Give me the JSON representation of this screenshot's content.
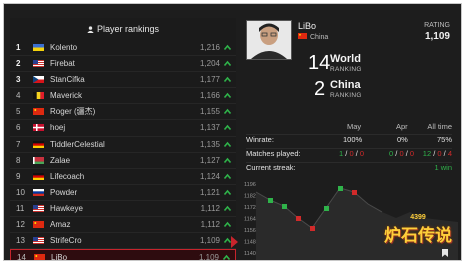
{
  "rankings": {
    "title": "Player rankings",
    "rows": [
      {
        "rank": "1",
        "flag": "ukraine",
        "name": "Kolento",
        "score": "1,216"
      },
      {
        "rank": "2",
        "flag": "usa",
        "name": "Firebat",
        "score": "1,204"
      },
      {
        "rank": "3",
        "flag": "czech",
        "name": "StanCifka",
        "score": "1,177"
      },
      {
        "rank": "4",
        "flag": "belgium",
        "name": "Maverick",
        "score": "1,166"
      },
      {
        "rank": "5",
        "flag": "china",
        "name": "Roger (疆杰)",
        "score": "1,155"
      },
      {
        "rank": "6",
        "flag": "denmark",
        "name": "hoej",
        "score": "1,137"
      },
      {
        "rank": "7",
        "flag": "germany",
        "name": "TiddlerCelestial",
        "score": "1,135"
      },
      {
        "rank": "8",
        "flag": "belarus",
        "name": "Zalae",
        "score": "1,127"
      },
      {
        "rank": "9",
        "flag": "germany",
        "name": "Lifecoach",
        "score": "1,124"
      },
      {
        "rank": "10",
        "flag": "russia",
        "name": "Powder",
        "score": "1,121"
      },
      {
        "rank": "11",
        "flag": "usa",
        "name": "Hawkeye",
        "score": "1,112"
      },
      {
        "rank": "12",
        "flag": "china",
        "name": "Amaz",
        "score": "1,112"
      },
      {
        "rank": "13",
        "flag": "usa",
        "name": "StrifeCro",
        "score": "1,109"
      },
      {
        "rank": "14",
        "flag": "china",
        "name": "LiBo",
        "score": "1,109"
      }
    ]
  },
  "player": {
    "name": "LiBo",
    "country": "China",
    "rating_label": "RATING",
    "rating": "1,109",
    "world_rank": "14",
    "world_label": "World",
    "world_sub": "RANKING",
    "country_rank": "2",
    "country_label": "China",
    "country_sub": "RANKING"
  },
  "stats": {
    "columns": [
      "May",
      "Apr",
      "All time"
    ],
    "winrate_label": "Winrate:",
    "winrate": [
      "100%",
      "0%",
      "75%"
    ],
    "matches_label": "Matches played:",
    "matches": [
      [
        "1",
        "0",
        "0"
      ],
      [
        "0",
        "0",
        "0"
      ],
      [
        "12",
        "0",
        "4"
      ]
    ],
    "streak_label": "Current streak:",
    "streak": "1 win"
  },
  "chart_data": {
    "type": "line",
    "yticks": [
      "1196",
      "1182",
      "1172",
      "1164",
      "1156",
      "1148",
      "1140"
    ],
    "ylim": [
      1140,
      1196
    ]
  },
  "logo": {
    "top": "4399",
    "main": "炉石传说"
  },
  "colors": {
    "accent_red": "#c7242c",
    "up_green": "#2fb34a",
    "down_red": "#d12a2a",
    "panel_bg": "#1d1d1d"
  }
}
